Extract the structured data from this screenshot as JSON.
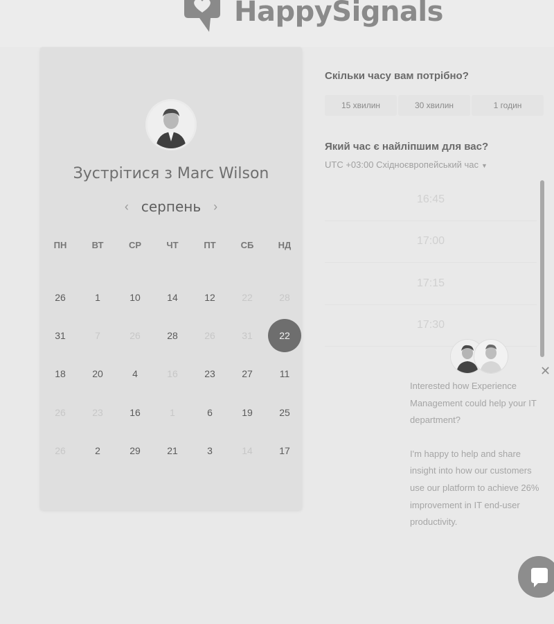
{
  "header": {
    "brand": "HappySignals"
  },
  "calendar": {
    "title": "Зустрітися з Marc Wilson",
    "month": "серпень",
    "weekdays": [
      "ПН",
      "ВТ",
      "СР",
      "ЧТ",
      "ПТ",
      "СБ",
      "НД"
    ],
    "days": [
      [
        {
          "t": "26",
          "m": false
        },
        {
          "t": "1",
          "m": false
        },
        {
          "t": "10",
          "m": false
        },
        {
          "t": "14",
          "m": false
        },
        {
          "t": "12",
          "m": false
        },
        {
          "t": "22",
          "m": true
        },
        {
          "t": "28",
          "m": true
        }
      ],
      [
        {
          "t": "31",
          "m": false
        },
        {
          "t": "7",
          "m": true
        },
        {
          "t": "26",
          "m": true
        },
        {
          "t": "28",
          "m": false
        },
        {
          "t": "26",
          "m": true
        },
        {
          "t": "31",
          "m": true
        },
        {
          "t": "22",
          "m": false,
          "sel": true
        }
      ],
      [
        {
          "t": "18",
          "m": false
        },
        {
          "t": "20",
          "m": false
        },
        {
          "t": "4",
          "m": false
        },
        {
          "t": "16",
          "m": true
        },
        {
          "t": "23",
          "m": false
        },
        {
          "t": "27",
          "m": false
        },
        {
          "t": "11",
          "m": false
        }
      ],
      [
        {
          "t": "26",
          "m": true
        },
        {
          "t": "23",
          "m": true
        },
        {
          "t": "16",
          "m": false
        },
        {
          "t": "1",
          "m": true
        },
        {
          "t": "6",
          "m": false
        },
        {
          "t": "19",
          "m": false
        },
        {
          "t": "25",
          "m": false
        }
      ],
      [
        {
          "t": "26",
          "m": true
        },
        {
          "t": "2",
          "m": false
        },
        {
          "t": "29",
          "m": false
        },
        {
          "t": "21",
          "m": false
        },
        {
          "t": "3",
          "m": false
        },
        {
          "t": "14",
          "m": true
        },
        {
          "t": "17",
          "m": false
        }
      ]
    ]
  },
  "booking": {
    "duration_question": "Скільки часу вам потрібно?",
    "durations": [
      "15 хвилин",
      "30 хвилин",
      "1 годин"
    ],
    "time_question": "Який час є найліпшим для вас?",
    "timezone": "UTC +03:00 Східноєвропейський час",
    "slots": [
      "16:45",
      "17:00",
      "17:15",
      "17:30"
    ]
  },
  "chat": {
    "message_1": "Interested how Experience Management could help your IT department?",
    "message_2": "I'm happy to help and share insight into how our customers use our platform to achieve 26% improvement in IT end-user productivity."
  }
}
